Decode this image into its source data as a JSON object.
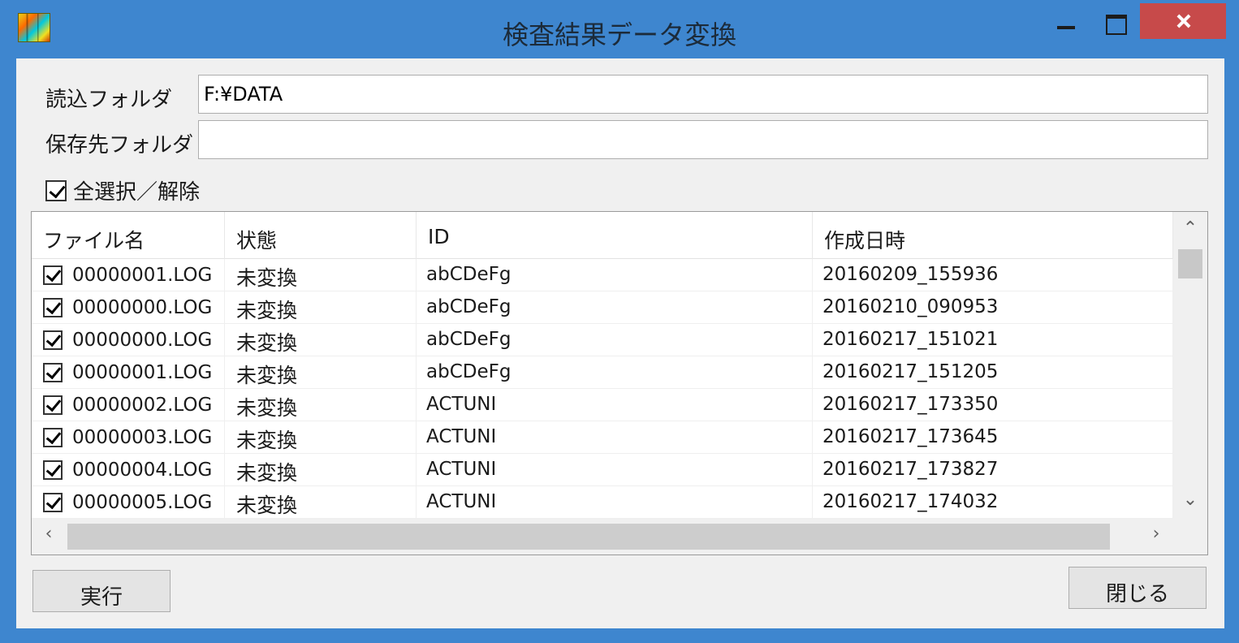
{
  "window": {
    "title": "検査結果データ変換",
    "icon": "app-icon"
  },
  "form": {
    "read_folder_label": "読込フォルダ",
    "read_folder_value": "F:¥DATA",
    "save_folder_label": "保存先フォルダ",
    "save_folder_value": "",
    "select_all_label": "全選択／解除",
    "select_all_checked": true
  },
  "table": {
    "columns": [
      "ファイル名",
      "状態",
      "ID",
      "作成日時"
    ],
    "rows": [
      {
        "name": "00000001.LOG",
        "state": "未変換",
        "id": "abCDeFg",
        "date": "20160209_155936",
        "checked": true
      },
      {
        "name": "00000000.LOG",
        "state": "未変換",
        "id": "abCDeFg",
        "date": "20160210_090953",
        "checked": true
      },
      {
        "name": "00000000.LOG",
        "state": "未変換",
        "id": "abCDeFg",
        "date": "20160217_151021",
        "checked": true
      },
      {
        "name": "00000001.LOG",
        "state": "未変換",
        "id": "abCDeFg",
        "date": "20160217_151205",
        "checked": true
      },
      {
        "name": "00000002.LOG",
        "state": "未変換",
        "id": "ACTUNI",
        "date": "20160217_173350",
        "checked": true
      },
      {
        "name": "00000003.LOG",
        "state": "未変換",
        "id": "ACTUNI",
        "date": "20160217_173645",
        "checked": true
      },
      {
        "name": "00000004.LOG",
        "state": "未変換",
        "id": "ACTUNI",
        "date": "20160217_173827",
        "checked": true
      },
      {
        "name": "00000005.LOG",
        "state": "未変換",
        "id": "ACTUNI",
        "date": "20160217_174032",
        "checked": true
      }
    ]
  },
  "buttons": {
    "execute": "実行",
    "close": "閉じる"
  },
  "colors": {
    "title_bar": "#3e86cf",
    "close_button": "#c74a4a",
    "client_bg": "#f0f0f0"
  }
}
